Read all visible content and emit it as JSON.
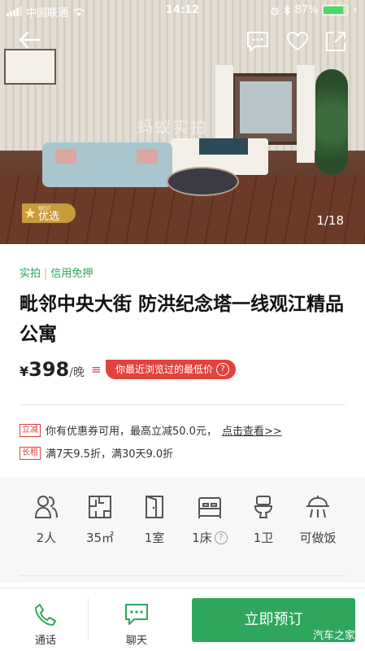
{
  "status_bar": {
    "carrier": "中国联通",
    "time": "14:12",
    "battery": "87%"
  },
  "gallery": {
    "watermark": "蚂蚁实拍",
    "counter": "1/18",
    "badge_small": "BEST",
    "badge_label": "优选"
  },
  "tags": [
    "实拍",
    "信用免押"
  ],
  "listing": {
    "title": "毗邻中央大街 防洪纪念塔一线观江精品公寓"
  },
  "price": {
    "currency": "¥",
    "amount": "398",
    "unit": "/晚",
    "lowest_label": "你最近浏览过的最低价",
    "help_icon": "?"
  },
  "promos": [
    {
      "tag": "立减",
      "text": "你有优惠券可用，最高立减50.0元，",
      "link": "点击查看>>"
    },
    {
      "tag": "长租",
      "text": "满7天9.5折，满30天9.0折",
      "link": ""
    }
  ],
  "facilities": [
    {
      "icon": "guests-icon",
      "label": "2人"
    },
    {
      "icon": "area-icon",
      "label": "35㎡"
    },
    {
      "icon": "room-door-icon",
      "label": "1室"
    },
    {
      "icon": "bed-icon",
      "label": "1床"
    },
    {
      "icon": "toilet-icon",
      "label": "1卫"
    },
    {
      "icon": "cooking-icon",
      "label": "可做饭"
    }
  ],
  "bottom_bar": {
    "call_label": "通话",
    "chat_label": "聊天",
    "book_label": "立即预订",
    "watermark": "汽车之家"
  },
  "colors": {
    "accent_green": "#2ea75c",
    "tag_green": "#2aa45f",
    "alert_red": "#e2433d"
  }
}
